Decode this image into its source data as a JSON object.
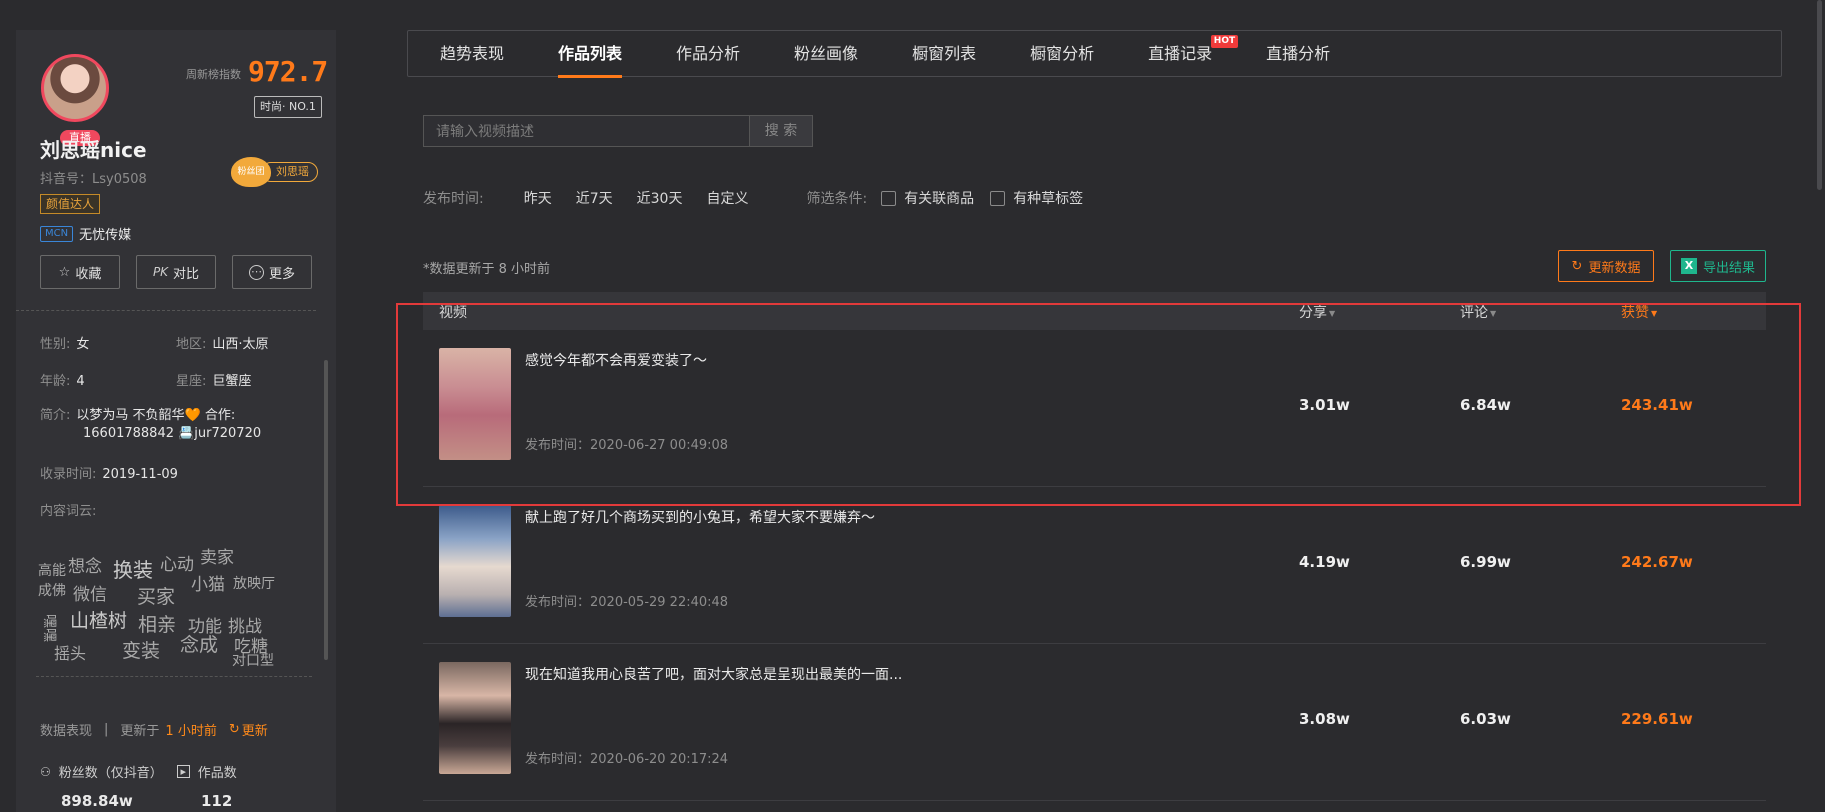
{
  "profile": {
    "weekly_label": "周新榜指数",
    "weekly_value": "972.7",
    "rank": "时尚· NO.1",
    "live_tag": "直播",
    "name": "刘思瑶nice",
    "account": "抖音号：Lsy0508",
    "fans_group_icon": "粉丝团",
    "fans_group_name": "刘思瑶",
    "category_tag": "颜值达人",
    "mcn_tag": "MCN",
    "mcn_name": "无忧传媒",
    "buttons": [
      {
        "label": "收藏",
        "icon": "star-icon",
        "glyph": "☆"
      },
      {
        "label": "对比",
        "icon": "pk-icon",
        "glyph": "PK"
      },
      {
        "label": "更多",
        "icon": "more-icon",
        "glyph": "⋯"
      }
    ],
    "gender_label": "性别:",
    "gender": "女",
    "region_label": "地区:",
    "region": "山西·太原",
    "age_label": "年龄:",
    "age": "4",
    "zodiac_label": "星座:",
    "zodiac": "巨蟹座",
    "bio_label": "简介:",
    "bio_line1": "以梦为马 不负韶华🧡 合作:",
    "bio_line2": "16601788842 📇jur720720",
    "collected_label": "收录时间:",
    "collected": "2019-11-09",
    "cloud_label": "内容词云:",
    "cloud_words": [
      "高能",
      "想念",
      "换装",
      "心动",
      "卖家",
      "成佛",
      "微信",
      "买家",
      "小猫",
      "放映厅",
      "山楂树",
      "相亲",
      "功能",
      "挑战",
      "摇头",
      "变装",
      "念成",
      "吃糖",
      "对口型",
      "嘿嘿"
    ],
    "data_label": "数据表现",
    "data_sep": "|",
    "updated_prefix": "更新于",
    "updated_value": "1 小时前",
    "refresh_label": "更新",
    "fans_label": "粉丝数（仅抖音）",
    "works_label": "作品数",
    "fans_value": "898.84w",
    "works_value": "112"
  },
  "tabs": [
    {
      "label": "趋势表现",
      "active": false
    },
    {
      "label": "作品列表",
      "active": true
    },
    {
      "label": "作品分析",
      "active": false
    },
    {
      "label": "粉丝画像",
      "active": false
    },
    {
      "label": "橱窗列表",
      "active": false
    },
    {
      "label": "橱窗分析",
      "active": false
    },
    {
      "label": "直播记录",
      "active": false,
      "badge": "HOT"
    },
    {
      "label": "直播分析",
      "active": false
    }
  ],
  "search": {
    "placeholder": "请输入视频描述",
    "button": "搜 索"
  },
  "filters": {
    "time_label": "发布时间:",
    "time_options": [
      "昨天",
      "近7天",
      "近30天",
      "自定义"
    ],
    "cond_label": "筛选条件:",
    "checkboxes": [
      "有关联商品",
      "有种草标签"
    ]
  },
  "update_note": "*数据更新于 8 小时前",
  "refresh_button": "更新数据",
  "export_button": "导出结果",
  "export_icon_text": "X",
  "table": {
    "headers": {
      "video": "视频",
      "share": "分享",
      "comment": "评论",
      "like": "获赞"
    },
    "rows": [
      {
        "title": "感觉今年都不会再爱变装了～",
        "time": "发布时间：2020-06-27 00:49:08",
        "share": "3.01w",
        "comment": "6.84w",
        "like": "243.41w"
      },
      {
        "title": "献上跑了好几个商场买到的小兔耳，希望大家不要嫌弃～",
        "time": "发布时间：2020-05-29 22:40:48",
        "share": "4.19w",
        "comment": "6.99w",
        "like": "242.67w"
      },
      {
        "title": "现在知道我用心良苦了吧，面对大家总是呈现出最美的一面...",
        "time": "发布时间：2020-06-20 20:17:24",
        "share": "3.08w",
        "comment": "6.03w",
        "like": "229.61w"
      }
    ]
  },
  "colors": {
    "accent": "#ff7a1a",
    "export": "#1fb68d",
    "highlight": "#e23a3a"
  }
}
